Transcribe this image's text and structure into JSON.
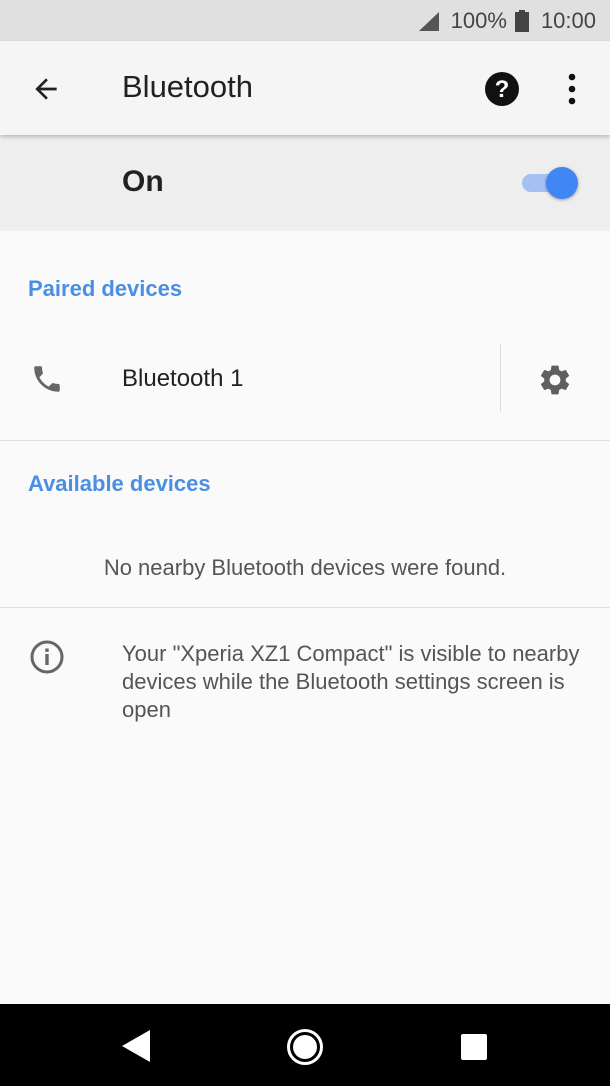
{
  "status_bar": {
    "battery": "100%",
    "time": "10:00",
    "icons": [
      "signal-icon",
      "battery-icon"
    ]
  },
  "app_bar": {
    "title": "Bluetooth",
    "icons": [
      "back-arrow-icon",
      "help-icon",
      "more-vert-icon"
    ]
  },
  "master_switch": {
    "label": "On",
    "state": true,
    "accent_color": "#4285f4"
  },
  "paired": {
    "header": "Paired devices",
    "devices": [
      {
        "name": "Bluetooth 1",
        "icon": "phone-icon",
        "settings_icon": "gear-icon"
      }
    ]
  },
  "available": {
    "header": "Available devices",
    "empty_message": "No nearby Bluetooth devices were found."
  },
  "info": {
    "icon": "info-icon",
    "text": "Your \"Xperia XZ1 Compact\" is visible to nearby devices while the Bluetooth settings screen is open"
  },
  "nav_bar": {
    "icons": [
      "nav-back-icon",
      "nav-home-icon",
      "nav-recents-icon"
    ]
  },
  "colors": {
    "section_header": "#4a8fe2",
    "primary_text": "#212121",
    "secondary_text": "#555555"
  }
}
